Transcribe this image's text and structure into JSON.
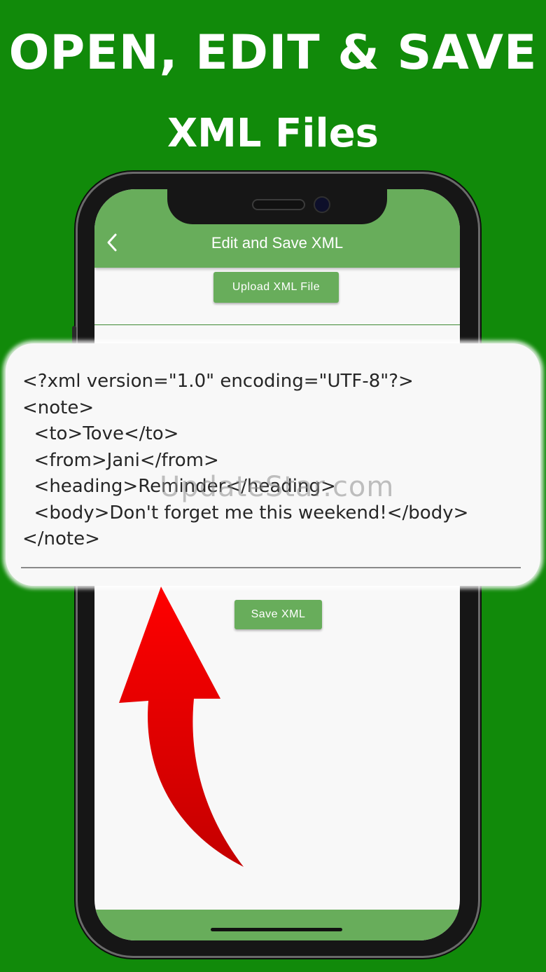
{
  "headline": {
    "line1": "OPEN, EDIT & SAVE",
    "line2": "XML Files"
  },
  "app": {
    "title": "Edit and Save XML",
    "back_icon": "chevron-left-icon",
    "upload_button": "Upload XML File",
    "save_button": "Save XML",
    "accent_color": "#68ad5b"
  },
  "editor": {
    "content": "<?xml version=\"1.0\" encoding=\"UTF-8\"?>\n<note>\n  <to>Tove</to>\n  <from>Jani</from>\n  <heading>Reminder</heading>\n  <body>Don't forget me this weekend!</body>\n</note>"
  },
  "watermark": "UpdateStar.com",
  "colors": {
    "background": "#118a0a",
    "arrow": "#e00000"
  }
}
